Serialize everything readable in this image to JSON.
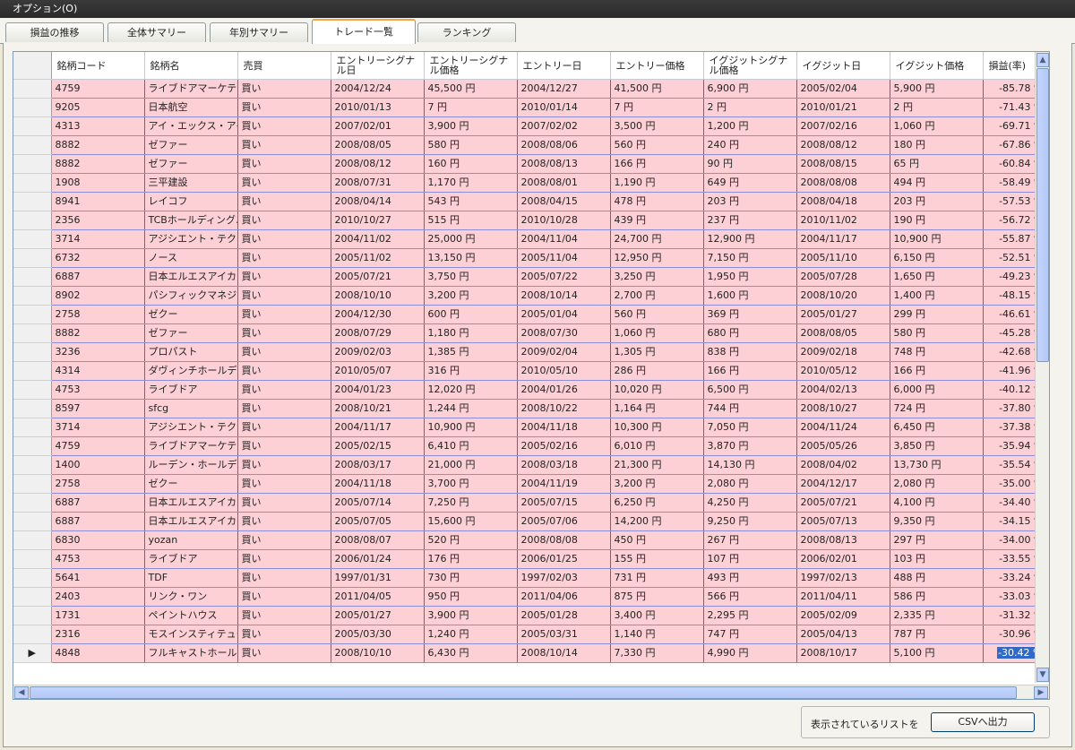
{
  "menu": {
    "options": "オプション(O)"
  },
  "tabs": [
    "損益の推移",
    "全体サマリー",
    "年別サマリー",
    "トレード一覧",
    "ランキング"
  ],
  "active_tab": 3,
  "columns": [
    "銘柄コード",
    "銘柄名",
    "売買",
    "エントリーシグナル日",
    "エントリーシグナル価格",
    "エントリー日",
    "エントリー価格",
    "イグジットシグナル価格",
    "イグジット日",
    "イグジット価格",
    "損益(率)"
  ],
  "rows": [
    [
      "4759",
      "ライブドアマーケティ…",
      "買い",
      "2004/12/24",
      "45,500 円",
      "2004/12/27",
      "41,500 円",
      "6,900 円",
      "2005/02/04",
      "5,900 円",
      "-85.78 %"
    ],
    [
      "9205",
      "日本航空",
      "買い",
      "2010/01/13",
      "7 円",
      "2010/01/14",
      "7 円",
      "2 円",
      "2010/01/21",
      "2 円",
      "-71.43 %"
    ],
    [
      "4313",
      "アイ・エックス・アイ",
      "買い",
      "2007/02/01",
      "3,900 円",
      "2007/02/02",
      "3,500 円",
      "1,200 円",
      "2007/02/16",
      "1,060 円",
      "-69.71 %"
    ],
    [
      "8882",
      "ゼファー",
      "買い",
      "2008/08/05",
      "580 円",
      "2008/08/06",
      "560 円",
      "240 円",
      "2008/08/12",
      "180 円",
      "-67.86 %"
    ],
    [
      "8882",
      "ゼファー",
      "買い",
      "2008/08/12",
      "160 円",
      "2008/08/13",
      "166 円",
      "90 円",
      "2008/08/15",
      "65 円",
      "-60.84 %"
    ],
    [
      "1908",
      "三平建設",
      "買い",
      "2008/07/31",
      "1,170 円",
      "2008/08/01",
      "1,190 円",
      "649 円",
      "2008/08/08",
      "494 円",
      "-58.49 %"
    ],
    [
      "8941",
      "レイコフ",
      "買い",
      "2008/04/14",
      "543 円",
      "2008/04/15",
      "478 円",
      "203 円",
      "2008/04/18",
      "203 円",
      "-57.53 %"
    ],
    [
      "2356",
      "TCBホールディング…",
      "買い",
      "2010/10/27",
      "515 円",
      "2010/10/28",
      "439 円",
      "237 円",
      "2010/11/02",
      "190 円",
      "-56.72 %"
    ],
    [
      "3714",
      "アジシエント・テクノ…",
      "買い",
      "2004/11/02",
      "25,000 円",
      "2004/11/04",
      "24,700 円",
      "12,900 円",
      "2004/11/17",
      "10,900 円",
      "-55.87 %"
    ],
    [
      "6732",
      "ノース",
      "買い",
      "2005/11/02",
      "13,150 円",
      "2005/11/04",
      "12,950 円",
      "7,150 円",
      "2005/11/10",
      "6,150 円",
      "-52.51 %"
    ],
    [
      "6887",
      "日本エルエスアイカ…",
      "買い",
      "2005/07/21",
      "3,750 円",
      "2005/07/22",
      "3,250 円",
      "1,950 円",
      "2005/07/28",
      "1,650 円",
      "-49.23 %"
    ],
    [
      "8902",
      "パシフィックマネジメ…",
      "買い",
      "2008/10/10",
      "3,200 円",
      "2008/10/14",
      "2,700 円",
      "1,600 円",
      "2008/10/20",
      "1,400 円",
      "-48.15 %"
    ],
    [
      "2758",
      "ゼクー",
      "買い",
      "2004/12/30",
      "600 円",
      "2005/01/04",
      "560 円",
      "369 円",
      "2005/01/27",
      "299 円",
      "-46.61 %"
    ],
    [
      "8882",
      "ゼファー",
      "買い",
      "2008/07/29",
      "1,180 円",
      "2008/07/30",
      "1,060 円",
      "680 円",
      "2008/08/05",
      "580 円",
      "-45.28 %"
    ],
    [
      "3236",
      "プロパスト",
      "買い",
      "2009/02/03",
      "1,385 円",
      "2009/02/04",
      "1,305 円",
      "838 円",
      "2009/02/18",
      "748 円",
      "-42.68 %"
    ],
    [
      "4314",
      "ダヴィンチホールデ…",
      "買い",
      "2010/05/07",
      "316 円",
      "2010/05/10",
      "286 円",
      "166 円",
      "2010/05/12",
      "166 円",
      "-41.96 %"
    ],
    [
      "4753",
      "ライブドア",
      "買い",
      "2004/01/23",
      "12,020 円",
      "2004/01/26",
      "10,020 円",
      "6,500 円",
      "2004/02/13",
      "6,000 円",
      "-40.12 %"
    ],
    [
      "8597",
      "sfcg",
      "買い",
      "2008/10/21",
      "1,244 円",
      "2008/10/22",
      "1,164 円",
      "744 円",
      "2008/10/27",
      "724 円",
      "-37.80 %"
    ],
    [
      "3714",
      "アジシエント・テクノ…",
      "買い",
      "2004/11/17",
      "10,900 円",
      "2004/11/18",
      "10,300 円",
      "7,050 円",
      "2004/11/24",
      "6,450 円",
      "-37.38 %"
    ],
    [
      "4759",
      "ライブドアマーケティ…",
      "買い",
      "2005/02/15",
      "6,410 円",
      "2005/02/16",
      "6,010 円",
      "3,870 円",
      "2005/05/26",
      "3,850 円",
      "-35.94 %"
    ],
    [
      "1400",
      "ルーデン・ホールデ…",
      "買い",
      "2008/03/17",
      "21,000 円",
      "2008/03/18",
      "21,300 円",
      "14,130 円",
      "2008/04/02",
      "13,730 円",
      "-35.54 %"
    ],
    [
      "2758",
      "ゼクー",
      "買い",
      "2004/11/18",
      "3,700 円",
      "2004/11/19",
      "3,200 円",
      "2,080 円",
      "2004/12/17",
      "2,080 円",
      "-35.00 %"
    ],
    [
      "6887",
      "日本エルエスアイカ…",
      "買い",
      "2005/07/14",
      "7,250 円",
      "2005/07/15",
      "6,250 円",
      "4,250 円",
      "2005/07/21",
      "4,100 円",
      "-34.40 %"
    ],
    [
      "6887",
      "日本エルエスアイカ…",
      "買い",
      "2005/07/05",
      "15,600 円",
      "2005/07/06",
      "14,200 円",
      "9,250 円",
      "2005/07/13",
      "9,350 円",
      "-34.15 %"
    ],
    [
      "6830",
      "yozan",
      "買い",
      "2008/08/07",
      "520 円",
      "2008/08/08",
      "450 円",
      "267 円",
      "2008/08/13",
      "297 円",
      "-34.00 %"
    ],
    [
      "4753",
      "ライブドア",
      "買い",
      "2006/01/24",
      "176 円",
      "2006/01/25",
      "155 円",
      "107 円",
      "2006/02/01",
      "103 円",
      "-33.55 %"
    ],
    [
      "5641",
      "TDF",
      "買い",
      "1997/01/31",
      "730 円",
      "1997/02/03",
      "731 円",
      "493 円",
      "1997/02/13",
      "488 円",
      "-33.24 %"
    ],
    [
      "2403",
      "リンク・ワン",
      "買い",
      "2011/04/05",
      "950 円",
      "2011/04/06",
      "875 円",
      "566 円",
      "2011/04/11",
      "586 円",
      "-33.03 %"
    ],
    [
      "1731",
      "ペイントハウス",
      "買い",
      "2005/01/27",
      "3,900 円",
      "2005/01/28",
      "3,400 円",
      "2,295 円",
      "2005/02/09",
      "2,335 円",
      "-31.32 %"
    ],
    [
      "2316",
      "モスインスティテュー…",
      "買い",
      "2005/03/30",
      "1,240 円",
      "2005/03/31",
      "1,140 円",
      "747 円",
      "2005/04/13",
      "787 円",
      "-30.96 %"
    ],
    [
      "4848",
      "フルキャストホール…",
      "買い",
      "2008/10/10",
      "6,430 円",
      "2008/10/14",
      "7,330 円",
      "4,990 円",
      "2008/10/17",
      "5,100 円",
      "-30.42 %"
    ]
  ],
  "current_row_marker": "▶",
  "scroll": {
    "up": "▲",
    "down": "▼",
    "left": "◀",
    "right": "▶"
  },
  "footer": {
    "label": "表示されているリストを",
    "csv_button": "CSVへ出力"
  }
}
